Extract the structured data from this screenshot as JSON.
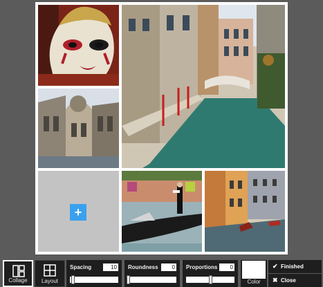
{
  "canvas": {
    "background": "#ffffff",
    "add_label": "+",
    "empty_cell_color": "#c3c3c3",
    "photos": [
      {
        "subject": "venetian-carnival-mask"
      },
      {
        "subject": "venice-canal-with-bridge"
      },
      {
        "subject": "st-marks-basilica"
      },
      {
        "subject": "gondolier-on-canal"
      },
      {
        "subject": "canal-houses"
      }
    ]
  },
  "toolbar": {
    "collage_label": "Collage",
    "layout_label": "Layout",
    "spacing": {
      "label": "Spacing",
      "value": "10",
      "level": 0.06
    },
    "roundness": {
      "label": "Roundness",
      "value": "0",
      "level": 0.0
    },
    "proportions": {
      "label": "Proportions",
      "value": "0",
      "level": 0.5
    },
    "color": {
      "label": "Color",
      "swatch": "#ffffff"
    },
    "finished_label": "Finished",
    "close_label": "Close",
    "finished_icon": "check-icon",
    "close_icon": "x-icon",
    "accent": "#3aa1ee"
  }
}
